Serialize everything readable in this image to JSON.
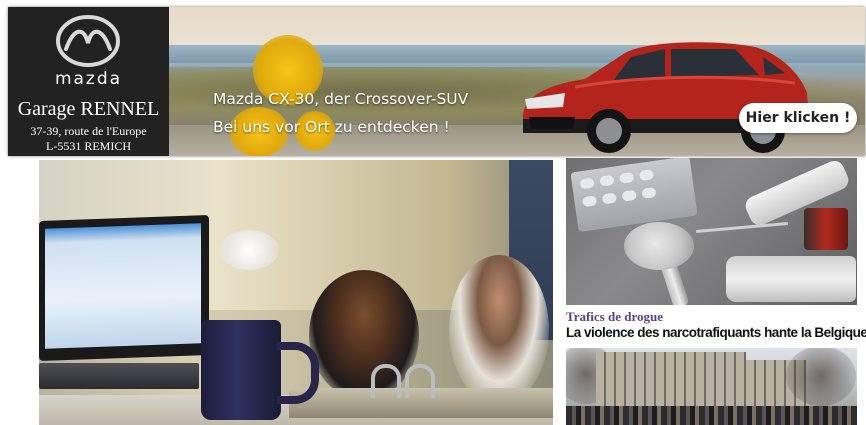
{
  "ad": {
    "brand_name": "mazda",
    "garage_name": "Garage RENNEL",
    "address_line1": "37-39, route de l'Europe",
    "address_line2": "L-5531 REMICH",
    "headline_line1": "Mazda CX-30, der Crossover-SUV",
    "headline_line2": "Bei uns vor Ort zu entdecken !",
    "cta_label": "Hier klicken !",
    "colors": {
      "brand_panel": "#222222",
      "car": "#b3241c"
    }
  },
  "articles": [
    {
      "id": "main",
      "image": "office-desk-laptop-mug-photo"
    },
    {
      "id": "drugs",
      "image": "drugs-syringe-spoon-photo",
      "kicker": "Trafics de drogue",
      "headline": "La violence des narcotrafiquants hante la Belgique",
      "kicker_color": "#5b3d8f"
    },
    {
      "id": "city",
      "image": "apartment-building-crowd-photo"
    }
  ]
}
